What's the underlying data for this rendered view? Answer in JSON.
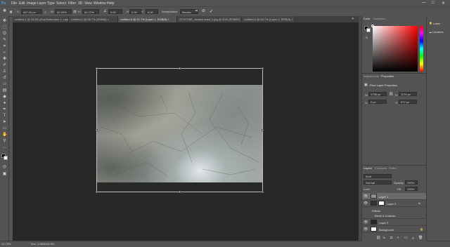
{
  "app": {
    "logo_text": "Ps"
  },
  "menu": [
    "File",
    "Edit",
    "Image",
    "Layer",
    "Type",
    "Select",
    "Filter",
    "3D",
    "View",
    "Window",
    "Help"
  ],
  "window_controls": {
    "minimize": "—",
    "maximize": "□",
    "close": "✕"
  },
  "options_bar": {
    "x_label": "X:",
    "x_value": "847.00 px",
    "w_label": "W:",
    "w_value": "82.29%",
    "h_label": "H:",
    "h_value": "82.27%",
    "angle_value": "0.00",
    "h_skew_value": "0.00",
    "v_skew_value": "0.00",
    "interp_label": "Interpolation:",
    "interp_value": "Bicubic"
  },
  "tabs": [
    {
      "label": "untitled-1 @ 33.3% (Hue/Saturation 1, Layer Mask/8) ×",
      "active": false
    },
    {
      "label": "Untitled-2 @ 66.7% (RGB/8) ×",
      "active": false
    },
    {
      "label": "Untitled-3 @ 41.7% (Layer 1, RGB/8) ×",
      "active": true
    },
    {
      "label": "STOCKBE_asdasd adsd_h.jpg @ 50% (RGB/8*) ×",
      "active": false
    },
    {
      "label": "Untitled-5 @ 66.7% (Layer 1, RGB/8) ×",
      "active": false
    }
  ],
  "status": {
    "zoom": "41.79%",
    "doc": "Doc: 6.86M/16.1M"
  },
  "color_panel": {
    "tabs": [
      "Color",
      "Swatches"
    ]
  },
  "right_strip": {
    "items": [
      "Learn",
      "Libraries"
    ]
  },
  "properties_panel": {
    "tabs": [
      "Adjustments",
      "Properties"
    ],
    "title": "Pixel Layer Properties",
    "w_label": "W:",
    "w_value": "1736 px",
    "h_label": "H:",
    "h_value": "1178 px",
    "x_label": "X:",
    "x_value": "0 px",
    "y_label": "Y:",
    "y_value": "572 px"
  },
  "layers_panel": {
    "tabs": [
      "Layers",
      "Channels",
      "Paths"
    ],
    "kind_label": "Kind",
    "blend_mode": "Normal",
    "opacity_label": "Opacity:",
    "opacity_value": "100%",
    "lock_label": "Lock:",
    "fill_label": "Fill:",
    "fill_value": "100%",
    "layers": [
      {
        "name": "Layer 1",
        "selected": true,
        "type": "texture"
      },
      {
        "name": "Layer 2",
        "selected": false,
        "type": "mask"
      },
      {
        "name": "Effects",
        "selected": false,
        "type": "effect"
      },
      {
        "name": "Bevel & Emboss",
        "selected": false,
        "type": "effect"
      },
      {
        "name": "Layer 3",
        "selected": false,
        "type": "dark"
      },
      {
        "name": "Background",
        "selected": false,
        "type": "white"
      }
    ]
  }
}
